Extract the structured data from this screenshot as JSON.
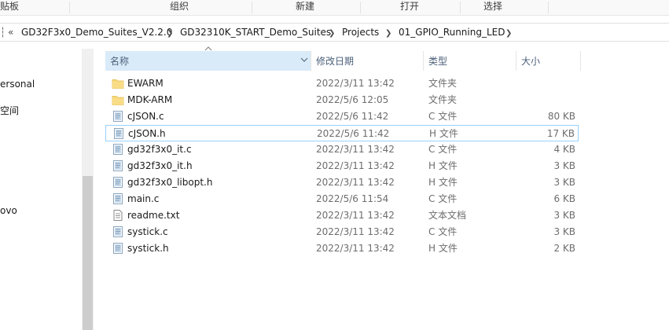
{
  "ribbon": {
    "groups": [
      "贴板",
      "组织",
      "新建",
      "打开",
      "选择"
    ]
  },
  "address": {
    "overflow": "«",
    "crumbs": [
      "GD32F3x0_Demo_Suites_V2.2.0",
      "GD32310K_START_Demo_Suites",
      "Projects",
      "01_GPIO_Running_LED"
    ]
  },
  "nav": {
    "items": [
      "ersonal",
      "空间",
      "ovo"
    ]
  },
  "columns": {
    "name": "名称",
    "date": "修改日期",
    "type": "类型",
    "size": "大小"
  },
  "files": [
    {
      "name": "EWARM",
      "date": "2022/3/11 13:42",
      "type": "文件夹",
      "size": "",
      "icon": "folder-icon"
    },
    {
      "name": "MDK-ARM",
      "date": "2022/5/6 12:05",
      "type": "文件夹",
      "size": "",
      "icon": "folder-icon"
    },
    {
      "name": "cJSON.c",
      "date": "2022/5/6 11:42",
      "type": "C 文件",
      "size": "80 KB",
      "icon": "source-file-icon"
    },
    {
      "name": "cJSON.h",
      "date": "2022/5/6 11:42",
      "type": "H 文件",
      "size": "17 KB",
      "icon": "source-file-icon"
    },
    {
      "name": "gd32f3x0_it.c",
      "date": "2022/3/11 13:42",
      "type": "C 文件",
      "size": "4 KB",
      "icon": "source-file-icon"
    },
    {
      "name": "gd32f3x0_it.h",
      "date": "2022/3/11 13:42",
      "type": "H 文件",
      "size": "3 KB",
      "icon": "source-file-icon"
    },
    {
      "name": "gd32f3x0_libopt.h",
      "date": "2022/3/11 13:42",
      "type": "H 文件",
      "size": "3 KB",
      "icon": "source-file-icon"
    },
    {
      "name": "main.c",
      "date": "2022/5/6 11:54",
      "type": "C 文件",
      "size": "6 KB",
      "icon": "source-file-icon"
    },
    {
      "name": "readme.txt",
      "date": "2022/3/11 13:42",
      "type": "文本文档",
      "size": "3 KB",
      "icon": "text-file-icon"
    },
    {
      "name": "systick.c",
      "date": "2022/3/11 13:42",
      "type": "C 文件",
      "size": "3 KB",
      "icon": "source-file-icon"
    },
    {
      "name": "systick.h",
      "date": "2022/3/11 13:42",
      "type": "H 文件",
      "size": "2 KB",
      "icon": "source-file-icon"
    }
  ],
  "colors": {
    "folder": "#f8d775",
    "header_selected": "#d9ebf9",
    "focus_border": "#99d1ff"
  }
}
